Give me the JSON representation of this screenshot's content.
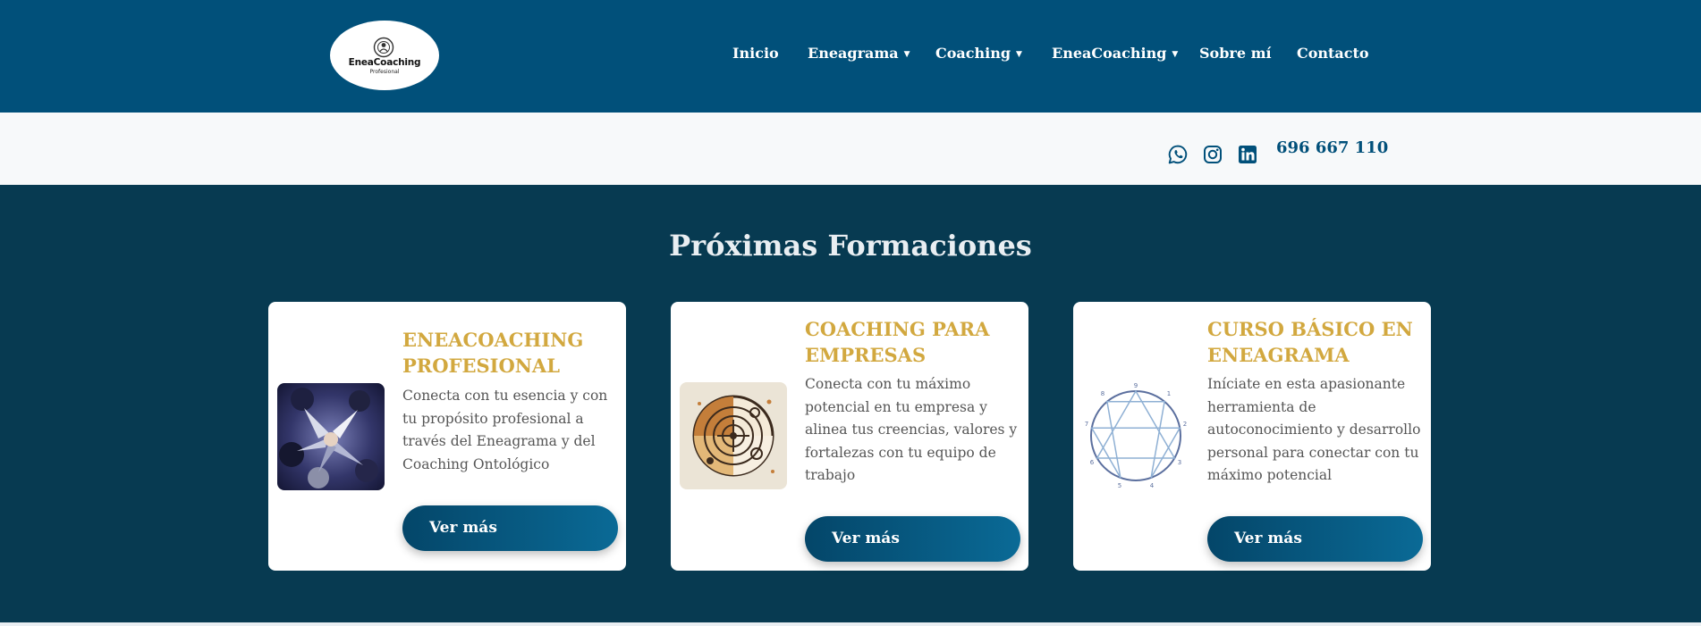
{
  "header": {
    "logo": {
      "name": "EneaCoaching",
      "sub": "Profesional"
    },
    "nav": [
      {
        "label": "Inicio",
        "has_dropdown": false
      },
      {
        "label": "Eneagrama",
        "has_dropdown": true
      },
      {
        "label": "Coaching",
        "has_dropdown": true
      },
      {
        "label": "EneaCoaching",
        "has_dropdown": true
      },
      {
        "label": "Sobre mí",
        "has_dropdown": false
      },
      {
        "label": "Contacto",
        "has_dropdown": false
      }
    ],
    "caret": "▼"
  },
  "contact_bar": {
    "icons": [
      "whatsapp-icon",
      "instagram-icon",
      "linkedin-icon"
    ],
    "phone": "696 667 110"
  },
  "section": {
    "title": "Próximas Formaciones",
    "cards": [
      {
        "title": "ENEACOACHING PROFESIONAL",
        "description": "Conecta con tu esencia y con tu propósito profesional a través del Eneagrama y del Coaching Ontológico",
        "button": "Ver más",
        "image": "team-hands-photo"
      },
      {
        "title": "COACHING PARA EMPRESAS",
        "description": "Conecta con tu máximo potencial en tu empresa y alinea tus creencias, valores y fortalezas con tu equipo de trabajo",
        "button": "Ver más",
        "image": "target-illustration"
      },
      {
        "title": "CURSO BÁSICO EN ENEAGRAMA",
        "description": "Iníciate en esta apasionante herramienta de autoconocimiento y desarrollo personal para conectar con tu máximo potencial",
        "button": "Ver más",
        "image": "enneagram-diagram"
      }
    ]
  },
  "enneagram_numbers": [
    "9",
    "1",
    "2",
    "3",
    "4",
    "5",
    "6",
    "7",
    "8"
  ],
  "colors": {
    "header_bg": "#01507a",
    "contact_bar_bg": "#f7f9fa",
    "section_bg": "#073a51",
    "card_title": "#d2a83f",
    "button_start": "#044669",
    "button_end": "#0a6a96"
  }
}
